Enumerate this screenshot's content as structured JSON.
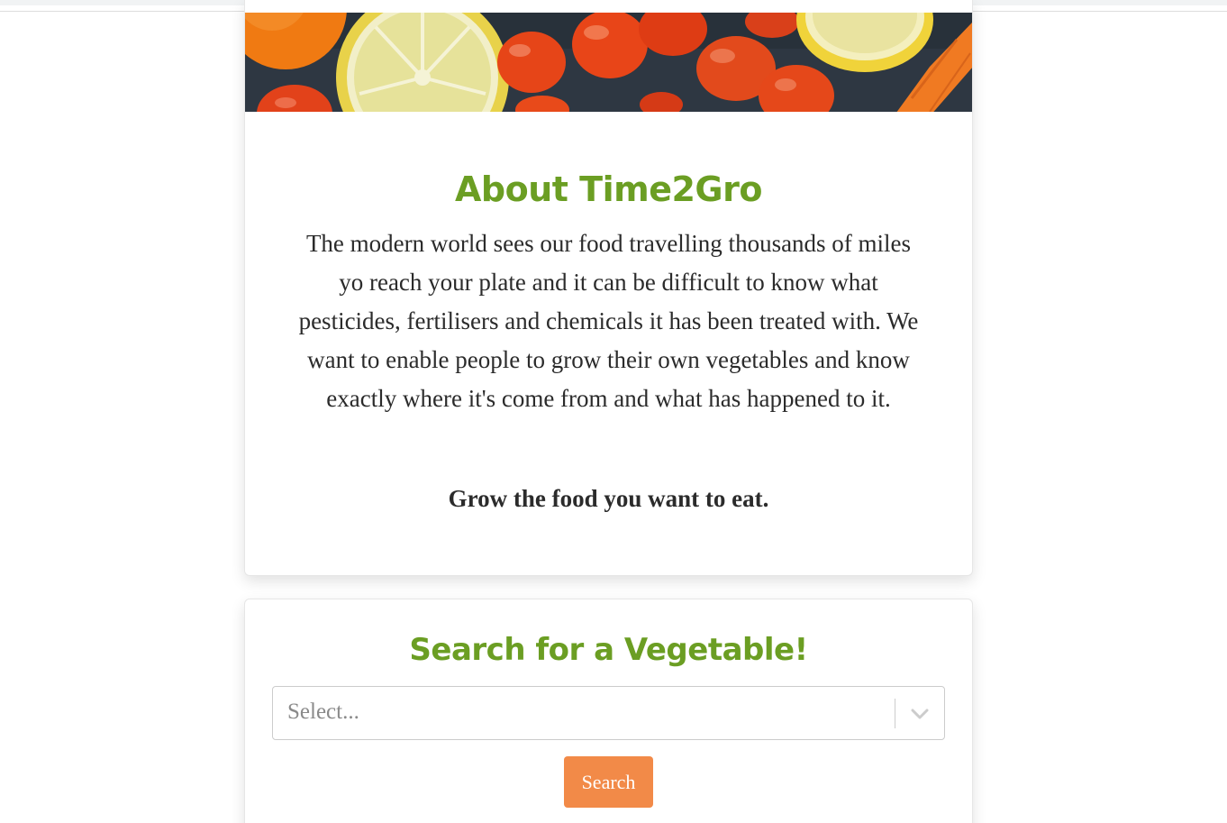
{
  "about": {
    "title": "About Time2Gro",
    "body": "The modern world sees our food travelling thousands of miles yo reach your plate and it can be difficult to know what pesticides, fertilisers and chemicals it has been treated with. We want to enable people to grow their own vegetables and know exactly where it's come from and what has happened to it.",
    "tagline": "Grow the food you want to eat."
  },
  "search": {
    "title": "Search for a Vegetable!",
    "select_placeholder": "Select...",
    "button_label": "Search"
  },
  "colors": {
    "heading": "#6b9e23",
    "button": "#f28a48",
    "text": "#2b2b2b"
  },
  "icons": {
    "select_indicator": "chevron-down-icon"
  }
}
